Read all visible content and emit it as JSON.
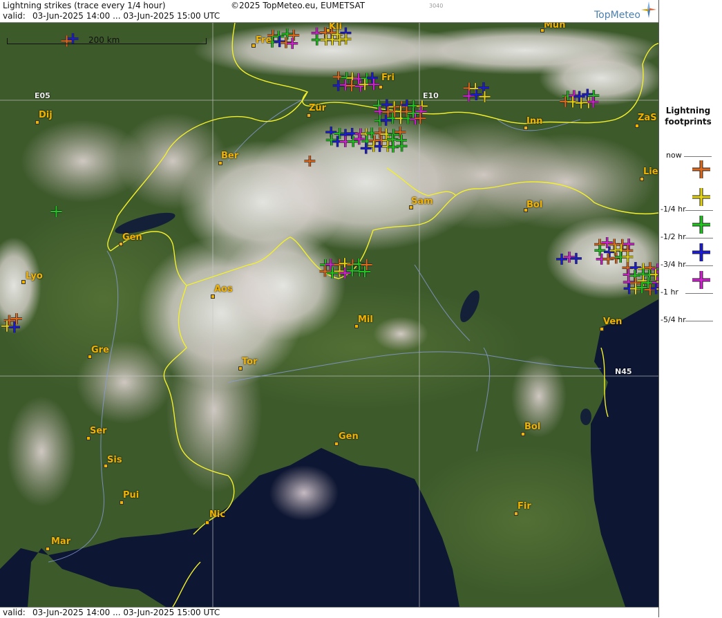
{
  "header": {
    "title": "Lightning strikes (trace every 1/4 hour)",
    "valid_label": "valid:",
    "valid_range": "03-Jun-2025 14:00 ... 03-Jun-2025 15:00 UTC",
    "copyright": "©2025 TopMeteo.eu, EUMETSAT",
    "code": "3040",
    "logo": "TopMeteo"
  },
  "footer": {
    "valid_label": "valid:",
    "valid_range": "03-Jun-2025 14:00 ... 03-Jun-2025 15:00 UTC"
  },
  "scale": {
    "label": "200 km"
  },
  "grid_labels": {
    "e05": "E05",
    "e10": "E10",
    "n45": "N45"
  },
  "legend": {
    "title_line1": "Lightning",
    "title_line2": "footprints",
    "rows": [
      {
        "label": "now",
        "color": "#e0691c"
      },
      {
        "label": "-1/4 hr",
        "color": "#e6d410"
      },
      {
        "label": "-1/2 hr",
        "color": "#1ec61e"
      },
      {
        "label": "-3/4 hr",
        "color": "#1a1adb"
      },
      {
        "label": "-1 hr",
        "color": "#d21fd2"
      },
      {
        "label": "-5/4 hr",
        "color": ""
      }
    ]
  },
  "cities": [
    {
      "name": "Mun"
    },
    {
      "name": "Fre"
    },
    {
      "name": "Kli"
    },
    {
      "name": "Fri"
    },
    {
      "name": "Dij"
    },
    {
      "name": "Zür"
    },
    {
      "name": "Inn"
    },
    {
      "name": "ZaS"
    },
    {
      "name": "Ber"
    },
    {
      "name": "Lie"
    },
    {
      "name": "Sam"
    },
    {
      "name": "Bol"
    },
    {
      "name": "Gen"
    },
    {
      "name": "Lyo"
    },
    {
      "name": "Aos"
    },
    {
      "name": "Mil"
    },
    {
      "name": "Ven"
    },
    {
      "name": "Gre"
    },
    {
      "name": "Tor"
    },
    {
      "name": "Ser"
    },
    {
      "name": "Gen"
    },
    {
      "name": "Bol"
    },
    {
      "name": "Sis"
    },
    {
      "name": "Pui"
    },
    {
      "name": "Nic"
    },
    {
      "name": "Fir"
    },
    {
      "name": "Mar"
    }
  ],
  "colors": {
    "border_yellow": "#f2ef2c",
    "river_blue": "#8a9cdc",
    "sea": "#0c1530",
    "land_green": "#3f5a2a"
  }
}
